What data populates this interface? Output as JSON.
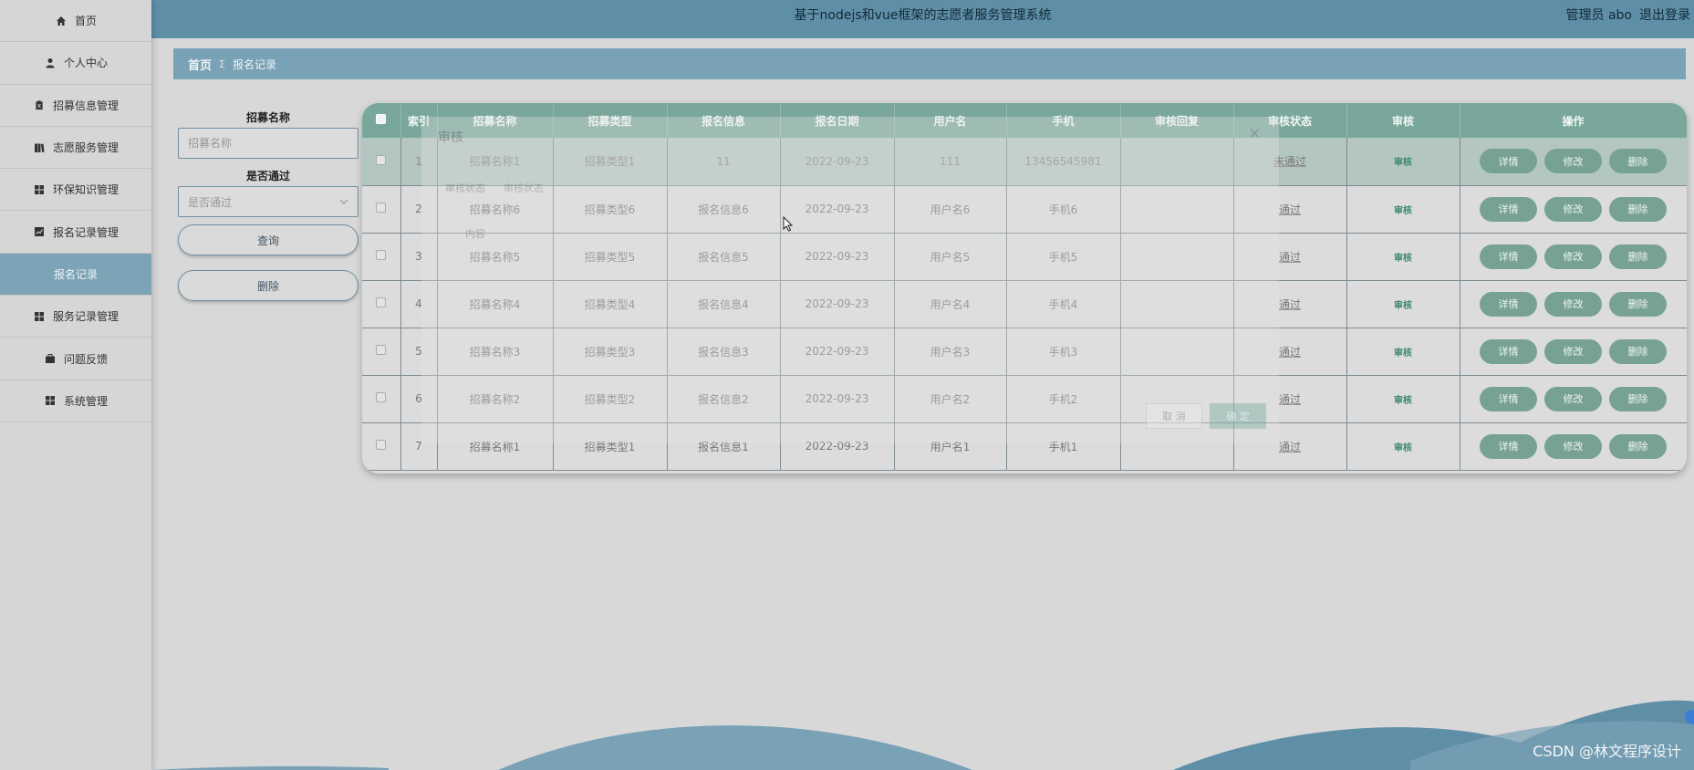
{
  "header": {
    "title": "基于nodejs和vue框架的志愿者服务管理系统",
    "user_label": "管理员 abo",
    "logout_label": "退出登录"
  },
  "sidebar": {
    "items": [
      {
        "label": "首页",
        "icon": "home-icon"
      },
      {
        "label": "个人中心",
        "icon": "user-icon"
      },
      {
        "label": "招募信息管理",
        "icon": "clipboard-icon"
      },
      {
        "label": "志愿服务管理",
        "icon": "book-icon"
      },
      {
        "label": "环保知识管理",
        "icon": "grid-icon"
      },
      {
        "label": "报名记录管理",
        "icon": "chart-icon"
      },
      {
        "label": "报名记录",
        "icon": ""
      },
      {
        "label": "服务记录管理",
        "icon": "grid-icon"
      },
      {
        "label": "问题反馈",
        "icon": "briefcase-icon"
      },
      {
        "label": "系统管理",
        "icon": "grid-icon"
      }
    ]
  },
  "breadcrumb": {
    "home": "首页",
    "separator": "Σ",
    "current": "报名记录"
  },
  "search": {
    "name_label": "招募名称",
    "name_placeholder": "招募名称",
    "pass_label": "是否通过",
    "pass_placeholder": "是否通过",
    "query_label": "查询",
    "delete_label": "删除"
  },
  "table": {
    "columns": [
      "索引",
      "招募名称",
      "招募类型",
      "报名信息",
      "报名日期",
      "用户名",
      "手机",
      "审核回复",
      "审核状态",
      "审核",
      "操作"
    ],
    "rows": [
      {
        "index": "1",
        "name": "招募名称1",
        "type": "招募类型1",
        "info": "11",
        "date": "2022-09-23",
        "user": "111",
        "phone": "13456545981",
        "reply": "",
        "status": "未通过",
        "audit": "审核"
      },
      {
        "index": "2",
        "name": "招募名称6",
        "type": "招募类型6",
        "info": "报名信息6",
        "date": "2022-09-23",
        "user": "用户名6",
        "phone": "手机6",
        "reply": "",
        "status": "通过",
        "audit": "审核"
      },
      {
        "index": "3",
        "name": "招募名称5",
        "type": "招募类型5",
        "info": "报名信息5",
        "date": "2022-09-23",
        "user": "用户名5",
        "phone": "手机5",
        "reply": "",
        "status": "通过",
        "audit": "审核"
      },
      {
        "index": "4",
        "name": "招募名称4",
        "type": "招募类型4",
        "info": "报名信息4",
        "date": "2022-09-23",
        "user": "用户名4",
        "phone": "手机4",
        "reply": "",
        "status": "通过",
        "audit": "审核"
      },
      {
        "index": "5",
        "name": "招募名称3",
        "type": "招募类型3",
        "info": "报名信息3",
        "date": "2022-09-23",
        "user": "用户名3",
        "phone": "手机3",
        "reply": "",
        "status": "通过",
        "audit": "审核"
      },
      {
        "index": "6",
        "name": "招募名称2",
        "type": "招募类型2",
        "info": "报名信息2",
        "date": "2022-09-23",
        "user": "用户名2",
        "phone": "手机2",
        "reply": "",
        "status": "通过",
        "audit": "审核"
      },
      {
        "index": "7",
        "name": "招募名称1",
        "type": "招募类型1",
        "info": "报名信息1",
        "date": "2022-09-23",
        "user": "用户名1",
        "phone": "手机1",
        "reply": "",
        "status": "通过",
        "audit": "审核"
      }
    ],
    "op_labels": {
      "detail": "详情",
      "edit": "修改",
      "delete": "删除"
    }
  },
  "modal": {
    "title": "审核",
    "close": "×",
    "status_label": "审核状态",
    "status_placeholder": "审核状态",
    "content_label": "内容",
    "cancel_label": "取 消",
    "ok_label": "确 定"
  },
  "watermark": "CSDN @林文程序设计",
  "colors": {
    "header": "#5f8ea7",
    "breadcrumb": "#7aa2b6",
    "table_header": "#7aa79b",
    "op_button": "#77a293"
  }
}
